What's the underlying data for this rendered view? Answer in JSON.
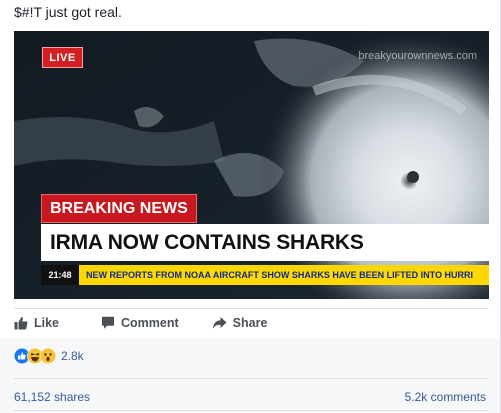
{
  "post": {
    "text": "$#!T just got real."
  },
  "media": {
    "watermark": "breakyourownnews.com",
    "live_label": "LIVE",
    "breaking_label": "BREAKING NEWS",
    "headline": "IRMA NOW CONTAINS SHARKS",
    "ticker_time": "21:48",
    "ticker_text": "NEW REPORTS FROM NOAA AIRCRAFT SHOW SHARKS HAVE BEEN LIFTED INTO HURRI"
  },
  "actions": {
    "like_label": "Like",
    "comment_label": "Comment",
    "share_label": "Share"
  },
  "reactions": {
    "icons": [
      "like-reaction-icon",
      "haha-reaction-icon",
      "wow-reaction-icon"
    ],
    "count": "2.8k"
  },
  "stats": {
    "shares": "61,152 shares",
    "comments": "5.2k comments"
  },
  "colors": {
    "link": "#385898",
    "live_red": "#d31f24",
    "ticker_yellow": "#ffd800",
    "facebook_blue": "#1877f2"
  }
}
